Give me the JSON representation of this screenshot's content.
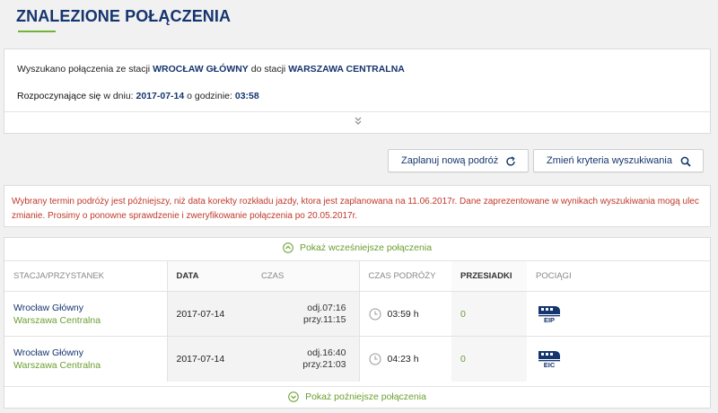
{
  "page": {
    "title": "ZNALEZIONE POŁĄCZENIA"
  },
  "summary": {
    "prefix": "Wyszukano połączenia ze stacji",
    "from_station": "WROCŁAW GŁÓWNY",
    "mid": "do stacji",
    "to_station": "WARSZAWA CENTRALNA",
    "start_prefix": "Rozpoczynające się",
    "start_mid": "w dniu:",
    "date": "2017-07-14",
    "time_mid": "o godzinie:",
    "time": "03:58"
  },
  "actions": {
    "plan_label": "Zaplanuj nową podróż",
    "criteria_label": "Zmień kryteria wyszukiwania"
  },
  "warning": "Wybrany termin podróży jest późniejszy, niż data korekty rozkładu jazdy, ktora jest zaplanowana na 11.06.2017r. Dane zaprezentowane w wynikach wyszukiwania mogą ulec zmianie. Prosimy o ponowne sprawdzenie i zweryfikowanie połączenia po 20.05.2017r.",
  "results": {
    "earlier_label": "Pokaż wcześniejsze połączenia",
    "later_label": "Pokaż poźniejsze połączenia",
    "columns": {
      "station": "STACJA/PRZYSTANEK",
      "date": "DATA",
      "time": "CZAS",
      "duration": "CZAS PODRÓŻY",
      "transfers": "PRZESIADKI",
      "trains": "POCIĄGI"
    },
    "rows": [
      {
        "from": "Wrocław Główny",
        "to": "Warszawa Centralna",
        "date": "2017-07-14",
        "dep": "odj.07:16",
        "arr": "przy.11:15",
        "duration": "03:59 h",
        "transfers": "0",
        "train": "EIP"
      },
      {
        "from": "Wrocław Główny",
        "to": "Warszawa Centralna",
        "date": "2017-07-14",
        "dep": "odj.16:40",
        "arr": "przy.21:03",
        "duration": "04:23 h",
        "transfers": "0",
        "train": "EIC"
      }
    ]
  },
  "icons": {
    "expand": "chevron-double-down-icon",
    "refresh": "refresh-icon",
    "search": "search-icon",
    "clock": "clock-icon",
    "train": "train-icon",
    "circle_up": "chevron-circle-up-icon",
    "circle_down": "chevron-circle-down-icon"
  },
  "colors": {
    "navy": "#15356e",
    "green": "#6a9f2f",
    "warning": "#c0392b"
  }
}
